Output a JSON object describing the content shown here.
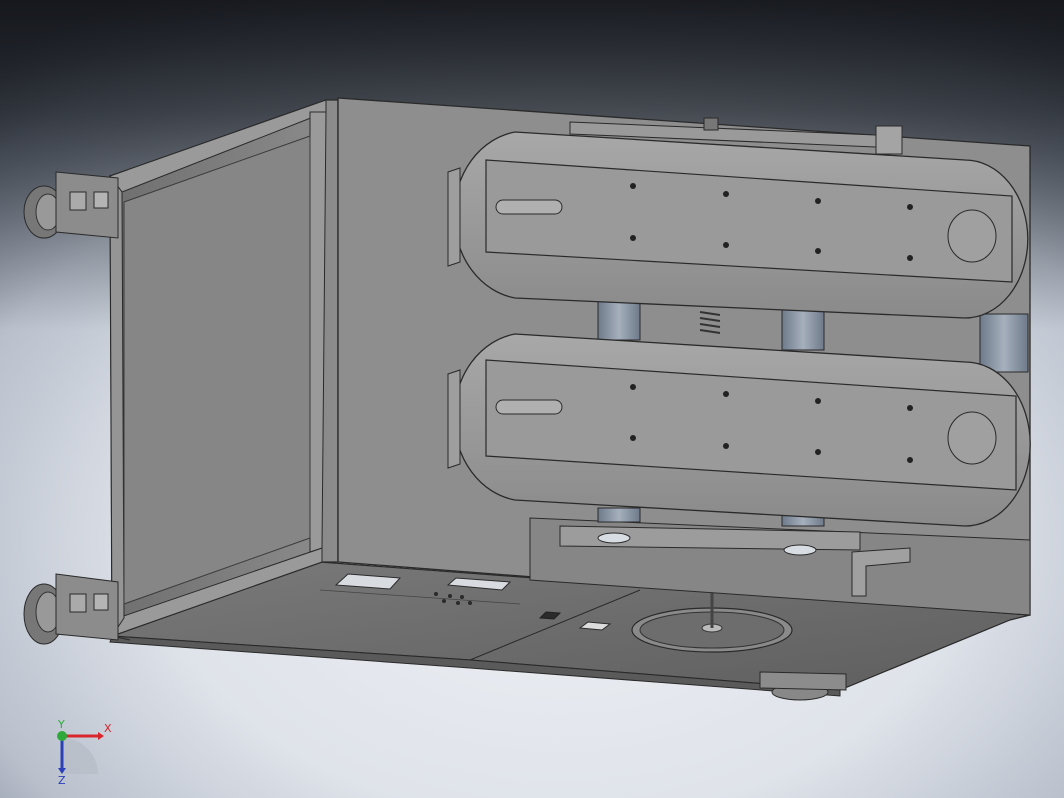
{
  "viewport": {
    "background_top": "#23262c",
    "background_mid": "#c3c8d1",
    "background_bottom": "#e3e6ec"
  },
  "model": {
    "body_color": "#8e8e8e",
    "edge_color": "#2a2a2a",
    "belt_color": "#9a9a9a",
    "roller_color": "#8a96a6"
  },
  "triad": {
    "x_label": "X",
    "y_label": "Y",
    "z_label": "Z",
    "x_color": "#d8262c",
    "y_color": "#2faa3a",
    "z_color": "#2a3fb8"
  }
}
